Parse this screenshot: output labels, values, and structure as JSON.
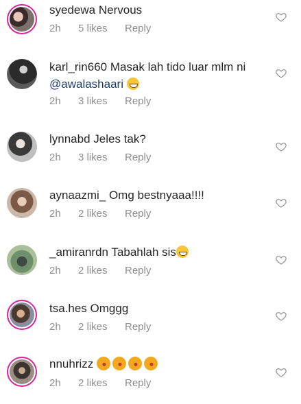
{
  "comments": [
    {
      "username": "syedewa",
      "text": "Nervous",
      "time": "2h",
      "likes": "5 likes",
      "reply": "Reply"
    },
    {
      "username": "karl_rin660",
      "text": "Masak lah tido luar mlm ni",
      "mention": "@awalashaari",
      "time": "2h",
      "likes": "3 likes",
      "reply": "Reply"
    },
    {
      "username": "lynnabd",
      "text": "Jeles tak?",
      "time": "2h",
      "likes": "3 likes",
      "reply": "Reply"
    },
    {
      "username": "aynaazmi_",
      "text": "Omg bestnyaaa!!!!",
      "time": "2h",
      "likes": "2 likes",
      "reply": "Reply"
    },
    {
      "username": "_amiranrdn",
      "text": "Tabahlah sis",
      "time": "2h",
      "likes": "2 likes",
      "reply": "Reply"
    },
    {
      "username": "tsa.hes",
      "text": "Omggg",
      "time": "2h",
      "likes": "2 likes",
      "reply": "Reply"
    },
    {
      "username": "nnuhrizz",
      "text": "",
      "time": "2h",
      "likes": "2 likes",
      "reply": "Reply"
    }
  ],
  "icons": {
    "like": "heart-outline-icon",
    "laugh": "laughing-face-emoji",
    "kiss": "kissing-face-emoji"
  },
  "colors": {
    "text": "#262626",
    "meta": "#8e8e8e",
    "mention": "#1c3a6b",
    "story_ring": "#d6249f"
  }
}
